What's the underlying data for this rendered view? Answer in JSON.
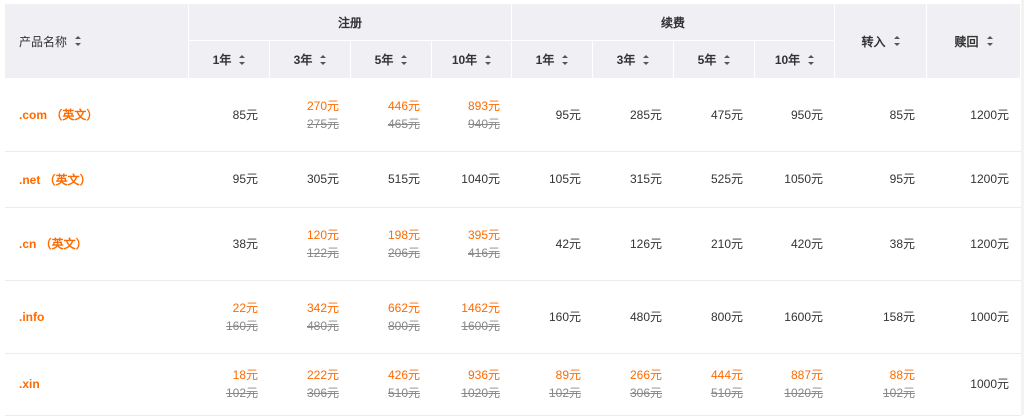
{
  "header": {
    "product_name": "产品名称",
    "register": "注册",
    "renew": "续费",
    "transfer": "转入",
    "redeem": "赎回",
    "register_years": [
      "1年",
      "3年",
      "5年",
      "10年"
    ],
    "renew_years": [
      "1年",
      "3年",
      "5年",
      "10年"
    ]
  },
  "rows": [
    {
      "name": ".com （英文）",
      "register": [
        {
          "price": "85元",
          "orig": null
        },
        {
          "price": "270元",
          "orig": "275元"
        },
        {
          "price": "446元",
          "orig": "465元"
        },
        {
          "price": "893元",
          "orig": "940元"
        }
      ],
      "renew": [
        {
          "price": "95元",
          "orig": null
        },
        {
          "price": "285元",
          "orig": null
        },
        {
          "price": "475元",
          "orig": null
        },
        {
          "price": "950元",
          "orig": null
        }
      ],
      "transfer": {
        "price": "85元",
        "orig": null
      },
      "redeem": {
        "price": "1200元",
        "orig": null
      }
    },
    {
      "name": ".net （英文）",
      "register": [
        {
          "price": "95元",
          "orig": null
        },
        {
          "price": "305元",
          "orig": null
        },
        {
          "price": "515元",
          "orig": null
        },
        {
          "price": "1040元",
          "orig": null
        }
      ],
      "renew": [
        {
          "price": "105元",
          "orig": null
        },
        {
          "price": "315元",
          "orig": null
        },
        {
          "price": "525元",
          "orig": null
        },
        {
          "price": "1050元",
          "orig": null
        }
      ],
      "transfer": {
        "price": "95元",
        "orig": null
      },
      "redeem": {
        "price": "1200元",
        "orig": null
      }
    },
    {
      "name": ".cn （英文）",
      "register": [
        {
          "price": "38元",
          "orig": null
        },
        {
          "price": "120元",
          "orig": "122元"
        },
        {
          "price": "198元",
          "orig": "206元"
        },
        {
          "price": "395元",
          "orig": "416元"
        }
      ],
      "renew": [
        {
          "price": "42元",
          "orig": null
        },
        {
          "price": "126元",
          "orig": null
        },
        {
          "price": "210元",
          "orig": null
        },
        {
          "price": "420元",
          "orig": null
        }
      ],
      "transfer": {
        "price": "38元",
        "orig": null
      },
      "redeem": {
        "price": "1200元",
        "orig": null
      }
    },
    {
      "name": ".info",
      "register": [
        {
          "price": "22元",
          "orig": "160元"
        },
        {
          "price": "342元",
          "orig": "480元"
        },
        {
          "price": "662元",
          "orig": "800元"
        },
        {
          "price": "1462元",
          "orig": "1600元"
        }
      ],
      "renew": [
        {
          "price": "160元",
          "orig": null
        },
        {
          "price": "480元",
          "orig": null
        },
        {
          "price": "800元",
          "orig": null
        },
        {
          "price": "1600元",
          "orig": null
        }
      ],
      "transfer": {
        "price": "158元",
        "orig": null
      },
      "redeem": {
        "price": "1000元",
        "orig": null
      }
    },
    {
      "name": ".xin",
      "register": [
        {
          "price": "18元",
          "orig": "102元"
        },
        {
          "price": "222元",
          "orig": "306元"
        },
        {
          "price": "426元",
          "orig": "510元"
        },
        {
          "price": "936元",
          "orig": "1020元"
        }
      ],
      "renew": [
        {
          "price": "89元",
          "orig": "102元"
        },
        {
          "price": "266元",
          "orig": "306元"
        },
        {
          "price": "444元",
          "orig": "510元"
        },
        {
          "price": "887元",
          "orig": "1020元"
        }
      ],
      "transfer": {
        "price": "88元",
        "orig": "102元"
      },
      "redeem": {
        "price": "1000元",
        "orig": null
      }
    }
  ],
  "colors": {
    "accent": "#ff6a00",
    "header_bg": "#efeff4",
    "strike": "#888888"
  }
}
